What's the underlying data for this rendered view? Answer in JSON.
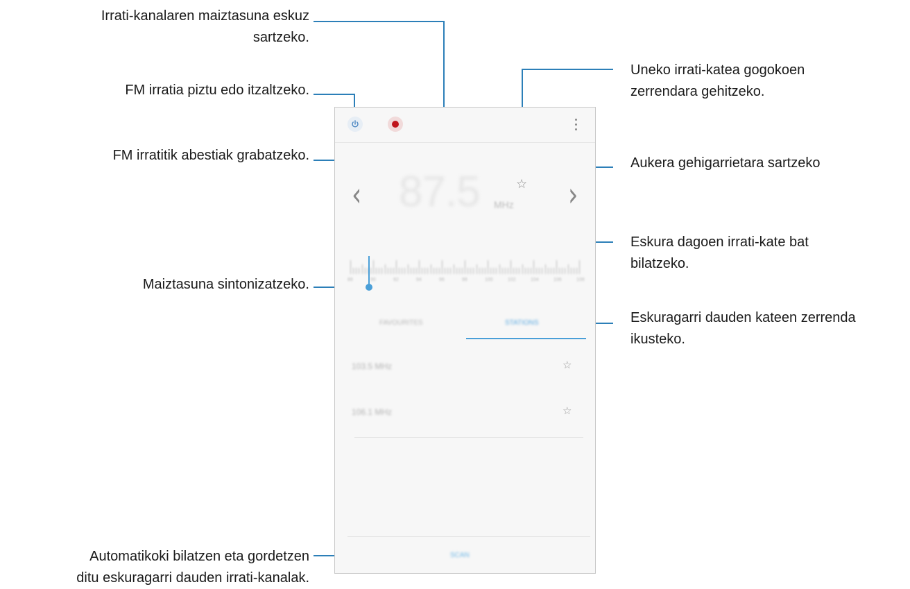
{
  "callouts": {
    "manual_freq_line1": "Irrati-kanalaren maiztasuna eskuz",
    "manual_freq_line2": "sartzeko.",
    "power": "FM irratia piztu edo itzaltzeko.",
    "record": "FM irratitik abestiak grabatzeko.",
    "favorite_line1": "Uneko irrati-katea gogokoen",
    "favorite_line2": "zerrendara gehitzeko.",
    "more_options": "Aukera gehigarrietara sartzeko",
    "search_line1": "Eskura dagoen irrati-kate bat",
    "search_line2": "bilatzeko.",
    "tune": "Maiztasuna sintonizatzeko.",
    "list_line1": "Eskuragarri dauden kateen zerrenda",
    "list_line2": "ikusteko.",
    "scan_line1": "Automatikoki bilatzen eta gordetzen",
    "scan_line2": "ditu eskuragarri dauden irrati-kanalak."
  },
  "screen": {
    "frequency": "87.5",
    "unit": "MHz",
    "tabs": [
      "FAVOURITES",
      "STATIONS"
    ],
    "stations": [
      "103.5 MHz",
      "106.1 MHz"
    ],
    "scan_label": "SCAN",
    "dial_labels": [
      "88",
      "90",
      "92",
      "94",
      "96",
      "98",
      "100",
      "102",
      "104",
      "106",
      "108"
    ]
  },
  "icons": {
    "power": "power-icon",
    "record": "record-icon",
    "menu": "more-options-icon",
    "star": "star-outline-icon",
    "prev": "chevron-left-icon",
    "next": "chevron-right-icon"
  },
  "colors": {
    "callout_line": "#2c7fb8",
    "accent": "#4a9fd8",
    "record": "#c0141b"
  }
}
